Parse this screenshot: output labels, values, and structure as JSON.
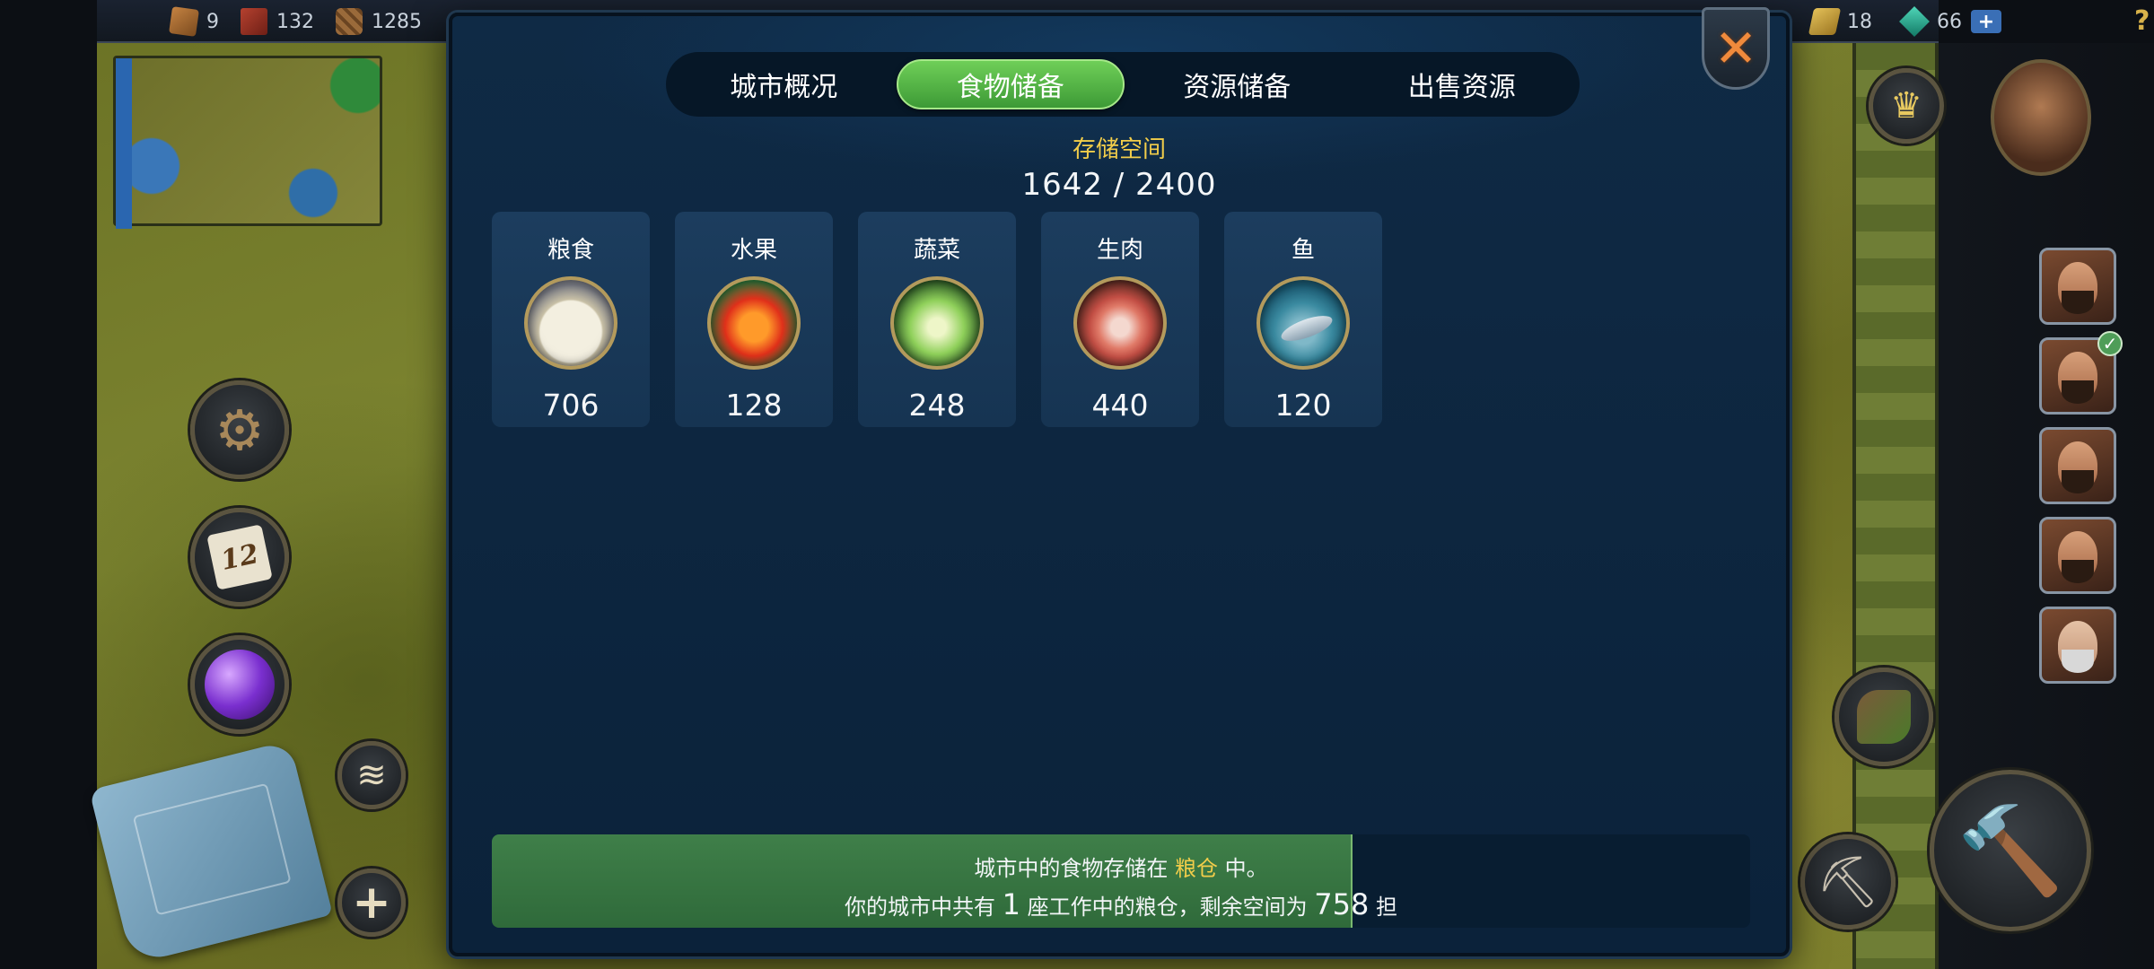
{
  "top_bar": {
    "resources_left": [
      {
        "icon": "crate-icon",
        "value": "9"
      },
      {
        "icon": "brick-icon",
        "value": "132"
      },
      {
        "icon": "lumber-icon",
        "value": "1285"
      }
    ],
    "resources_right": [
      {
        "icon": "gold-bars-icon",
        "value": "18"
      },
      {
        "icon": "gem-icon",
        "value": "66"
      }
    ],
    "add_label": "+",
    "help_label": "?"
  },
  "left_controls": {
    "calendar_number": "12"
  },
  "dialog": {
    "tabs": [
      {
        "label": "城市概况",
        "active": false
      },
      {
        "label": "食物储备",
        "active": true
      },
      {
        "label": "资源储备",
        "active": false
      },
      {
        "label": "出售资源",
        "active": false
      }
    ],
    "storage_label": "存储空间",
    "storage_value": "1642 / 2400",
    "storage_fill_fraction": 0.684,
    "foods": [
      {
        "name": "粮食",
        "icon": "grain-sack-icon",
        "count": "706"
      },
      {
        "name": "水果",
        "icon": "apple-icon",
        "count": "128"
      },
      {
        "name": "蔬菜",
        "icon": "cabbage-icon",
        "count": "248"
      },
      {
        "name": "生肉",
        "icon": "raw-meat-icon",
        "count": "440"
      },
      {
        "name": "鱼",
        "icon": "fish-icon",
        "count": "120"
      }
    ],
    "info": {
      "line1_prefix": "城市中的食物存储在 ",
      "line1_highlight": "粮仓",
      "line1_suffix": " 中。",
      "line2_prefix": "你的城市中共有 ",
      "line2_count": "1",
      "line2_middle": " 座工作中的粮仓，剩余空间为 ",
      "line2_remaining": "758",
      "line2_suffix": " 担"
    },
    "colors": {
      "accent_yellow": "#f2cd4a",
      "active_tab_green": "#4fb043",
      "panel_blue": "#0f2a45"
    }
  }
}
